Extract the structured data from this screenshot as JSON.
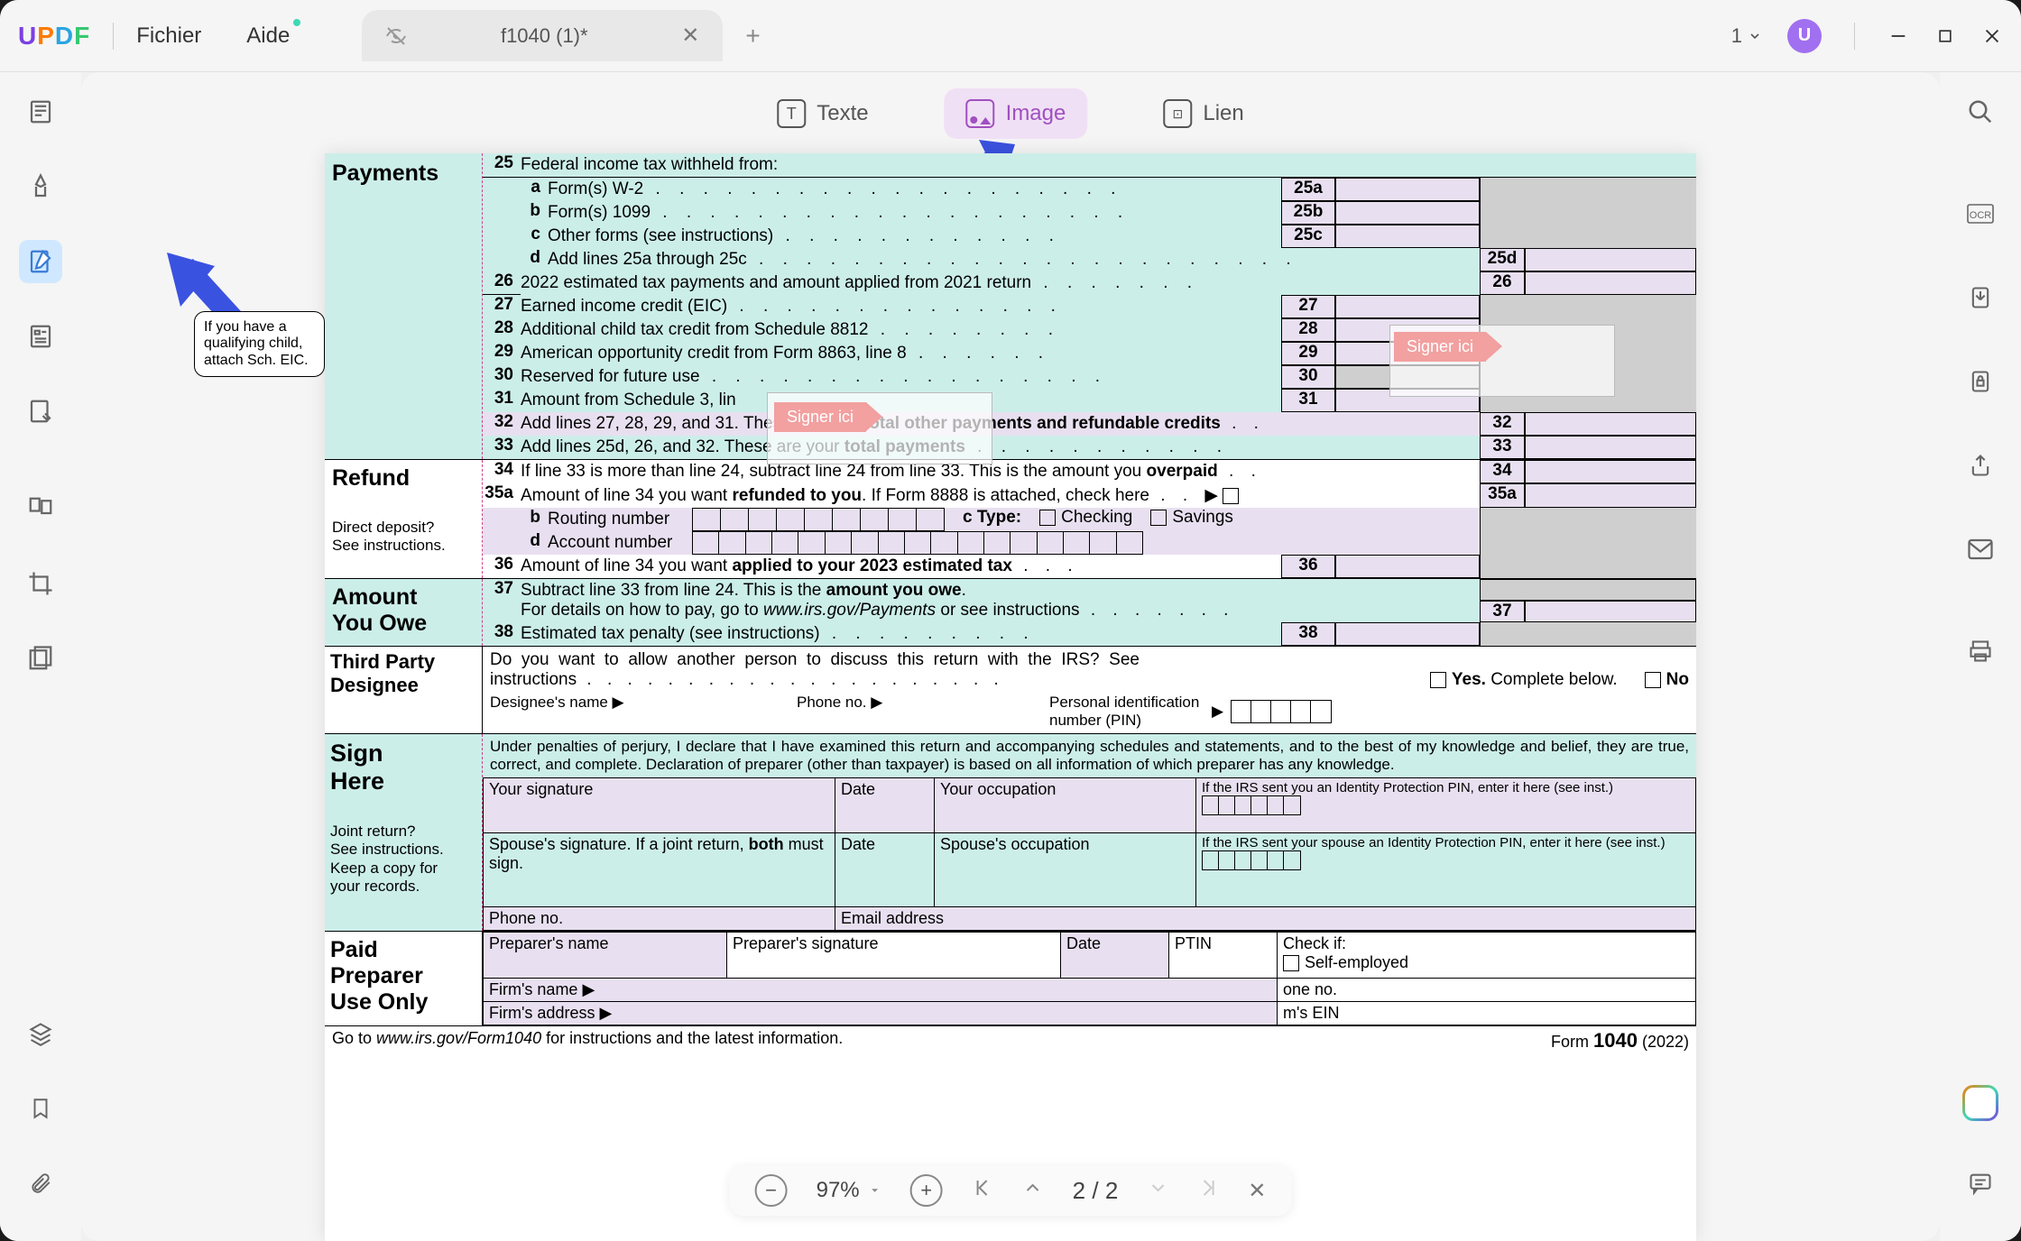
{
  "app": {
    "logo": "UPDF"
  },
  "menu": {
    "file": "Fichier",
    "help": "Aide"
  },
  "tab": {
    "title": "f1040 (1)*"
  },
  "window": {
    "count": "1"
  },
  "avatar": {
    "initial": "U"
  },
  "toolbar": {
    "text": "Texte",
    "image": "Image",
    "link": "Lien"
  },
  "zoom": {
    "value": "97%"
  },
  "pager": {
    "current": "2",
    "sep": "/",
    "total": "2"
  },
  "sign": {
    "tag1": "Signer ici",
    "tag2": "Signer ici"
  },
  "note": {
    "text": "If you have a qualifying child, attach Sch. EIC."
  },
  "form": {
    "payments_label": "Payments",
    "l25": "Federal income tax withheld from:",
    "l25a": "Form(s) W-2",
    "l25b": "Form(s) 1099",
    "l25c": "Other forms (see instructions)",
    "l25d": "Add lines 25a through 25c",
    "l26": "2022 estimated tax payments and amount applied from 2021 return",
    "l27": "Earned income credit (EIC)",
    "l28": "Additional child tax credit from Schedule 8812",
    "l29": "American opportunity credit from Form 8863, line 8",
    "l30": "Reserved for future use",
    "l31": "Amount from Schedule 3, lin",
    "l32a": "Add lines 27, 28, 29, and 31. These are your ",
    "l32b": "total other payments and refundable credits",
    "l33a": "Add lines 25d, 26, and 32. These are your ",
    "l33b": "total payments",
    "refund_label": "Refund",
    "l34a": "If line 33 is more than line 24, subtract line 24 from line 33. This is the amount you ",
    "l34b": "overpaid",
    "l35a_a": "Amount of line 34 you want ",
    "l35a_b": "refunded to you",
    "l35a_c": ". If Form 8888 is attached, check here",
    "l35b": "Routing number",
    "l35c_label": "c Type:",
    "l35c_checking": "Checking",
    "l35c_savings": "Savings",
    "l35d": "Account number",
    "l36a": "Amount of line 34 you want ",
    "l36b": "applied to your 2023 estimated tax",
    "dd_label1": "Direct deposit?",
    "dd_label2": "See instructions.",
    "owe_label1": "Amount",
    "owe_label2": "You Owe",
    "l37a": "Subtract line 33 from line 24. This is the ",
    "l37b": "amount you owe",
    "l37c": "For details on how to pay, go to ",
    "l37d": "www.irs.gov/Payments",
    "l37e": " or see instructions",
    "l38": "Estimated tax penalty (see instructions)",
    "third_label1": "Third Party",
    "third_label2": "Designee",
    "third_q": "Do you want to allow another person to discuss this return with the IRS? See instructions",
    "third_yes": "Yes.",
    "third_yes2": " Complete below.",
    "third_no": "No",
    "designee_name": "Designee's name",
    "phone_no": "Phone no.",
    "pin": "Personal identification number (PIN)",
    "sign_label1": "Sign",
    "sign_label2": "Here",
    "perjury": "Under penalties of perjury, I declare that I have examined this return and accompanying schedules and statements, and to the best of my knowledge and belief, they are true, correct, and complete. Declaration of preparer (other than taxpayer) is based on all information of which preparer has any knowledge.",
    "joint1": "Joint return?",
    "joint2": "See instructions.",
    "joint3": "Keep a copy for",
    "joint4": "your records.",
    "your_sig": "Your signature",
    "date": "Date",
    "your_occ": "Your occupation",
    "irs_pin1": "If the IRS sent you an Identity Protection PIN, enter it here (see inst.)",
    "spouse_sig_a": "Spouse's signature. If a joint return, ",
    "spouse_sig_b": "both",
    "spouse_sig_c": " must sign.",
    "spouse_occ": "Spouse's occupation",
    "irs_pin2": "If the IRS sent your spouse an Identity Protection PIN, enter it here (see inst.)",
    "phone_no2": "Phone no.",
    "email": "Email address",
    "paid_label1": "Paid",
    "paid_label2": "Preparer",
    "paid_label3": "Use Only",
    "prep_name": "Preparer's name",
    "prep_sig": "Preparer's signature",
    "ptin": "PTIN",
    "check_if": "Check if:",
    "self_emp": "Self-employed",
    "firm_name": "Firm's name",
    "firm_phone": "one no.",
    "firm_addr": "Firm's address",
    "firm_ein": "m's EIN",
    "footer_a": "Go to ",
    "footer_b": "www.irs.gov/Form1040",
    "footer_c": " for instructions and the latest information.",
    "footer_form": "Form ",
    "footer_1040": "1040",
    "footer_year": " (2022)",
    "n25": "25",
    "n25a": "25a",
    "n25b": "25b",
    "n25c": "25c",
    "n25d": "25d",
    "n26": "26",
    "n27": "27",
    "n28": "28",
    "n29": "29",
    "n30": "30",
    "n31": "31",
    "n32": "32",
    "n33": "33",
    "n34": "34",
    "n35a": "35a",
    "n35b": "b",
    "n35d": "d",
    "n36": "36",
    "n37": "37",
    "n38": "38",
    "na": "a",
    "nb": "b",
    "nc": "c",
    "nd": "d"
  }
}
